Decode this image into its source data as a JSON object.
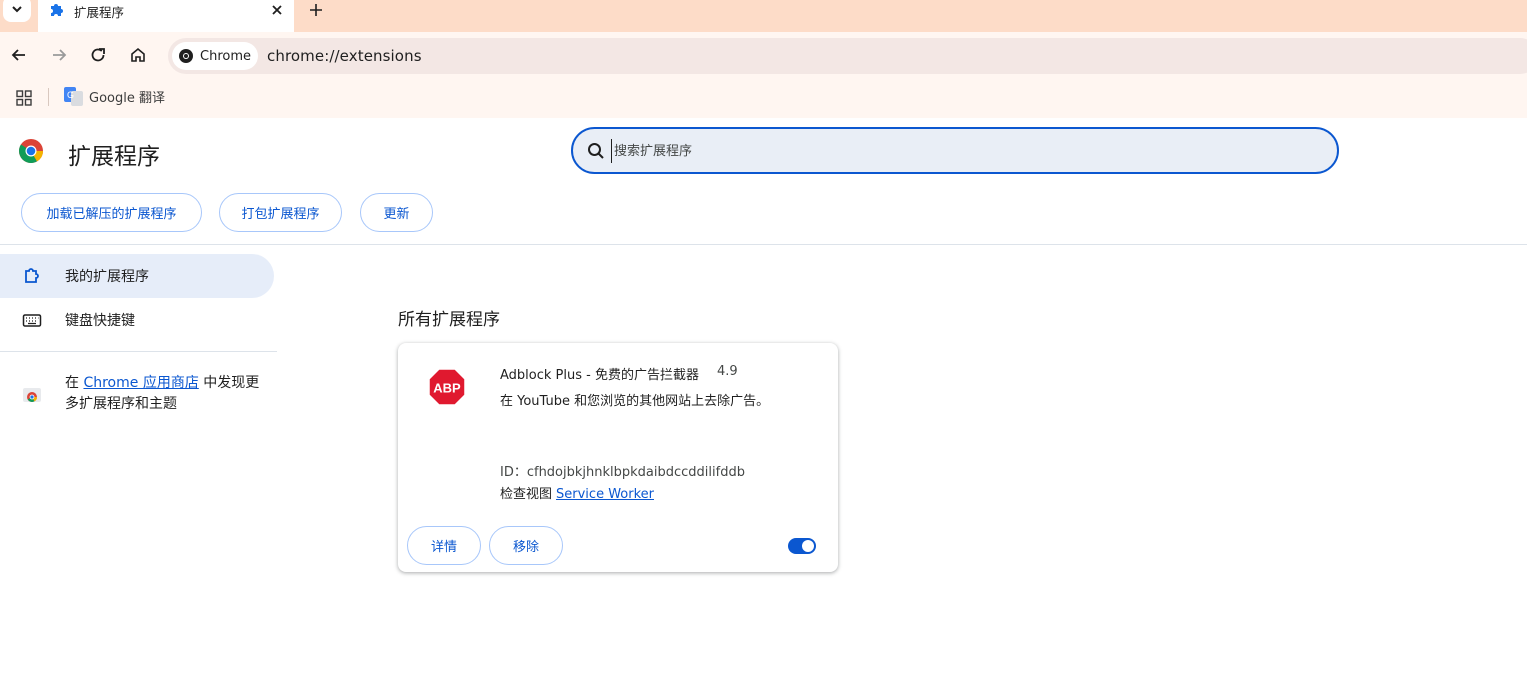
{
  "browser": {
    "tab": {
      "title": "扩展程序",
      "icon": "puzzle-icon"
    },
    "omnibox": {
      "chip_label": "Chrome",
      "url": "chrome://extensions"
    },
    "bookmarks": [
      {
        "label": "Google 翻译",
        "icon": "google-translate-icon"
      }
    ]
  },
  "header": {
    "title": "扩展程序",
    "search": {
      "placeholder": "搜索扩展程序"
    }
  },
  "toolbar": {
    "load_unpacked": "加载已解压的扩展程序",
    "pack": "打包扩展程序",
    "update": "更新"
  },
  "sidebar": {
    "items": [
      {
        "label": "我的扩展程序",
        "icon": "extension-icon",
        "active": true
      },
      {
        "label": "键盘快捷键",
        "icon": "keyboard-icon",
        "active": false
      }
    ],
    "store": {
      "prefix": "在",
      "link": "Chrome 应用商店",
      "suffix": "中发现更多扩展程序和主题"
    }
  },
  "main": {
    "section_title": "所有扩展程序",
    "extensions": [
      {
        "name": "Adblock Plus - 免费的广告拦截器",
        "version": "4.9",
        "description": "在 YouTube 和您浏览的其他网站上去除广告。",
        "id": "ID：cfhdojbkjhnklbpkdaibdccddilifddb",
        "inspect_label": "检查视图",
        "inspect_link": "Service Worker",
        "details_label": "详情",
        "remove_label": "移除",
        "enabled": true,
        "icon": "abp-icon",
        "icon_text": "ABP"
      }
    ]
  },
  "colors": {
    "accent": "#0b57d0",
    "tabbar": "#fddcc8",
    "toolbar": "#fff6f1",
    "abp_red": "#e0192f"
  }
}
